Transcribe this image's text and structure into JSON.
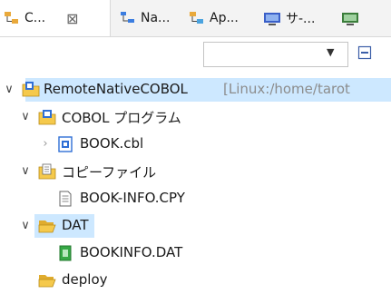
{
  "tabs": [
    {
      "label": "C...",
      "icon": "package-explorer-icon",
      "active": true
    },
    {
      "label": "Na...",
      "icon": "navigator-icon",
      "active": false
    },
    {
      "label": "Ap...",
      "icon": "application-icon",
      "active": false
    },
    {
      "label": "サ-...",
      "icon": "server-icon",
      "active": false
    }
  ],
  "tree": {
    "project": {
      "label": "RemoteNativeCOBOL",
      "decoration": "[Linux:/home/tarot"
    },
    "cobol_programs": {
      "label": "COBOL プログラム"
    },
    "book_cbl": {
      "label": "BOOK.cbl"
    },
    "copy_files": {
      "label": "コピーファイル"
    },
    "book_info_cpy": {
      "label": "BOOK-INFO.CPY"
    },
    "dat_folder": {
      "label": "DAT"
    },
    "bookinfo_dat": {
      "label": "BOOKINFO.DAT"
    },
    "deploy_folder": {
      "label": "deploy"
    }
  },
  "colors": {
    "selection": "#cde8ff",
    "folder": "#f5c94c",
    "project_blue": "#2f6fd6",
    "dat_green": "#36a845"
  }
}
